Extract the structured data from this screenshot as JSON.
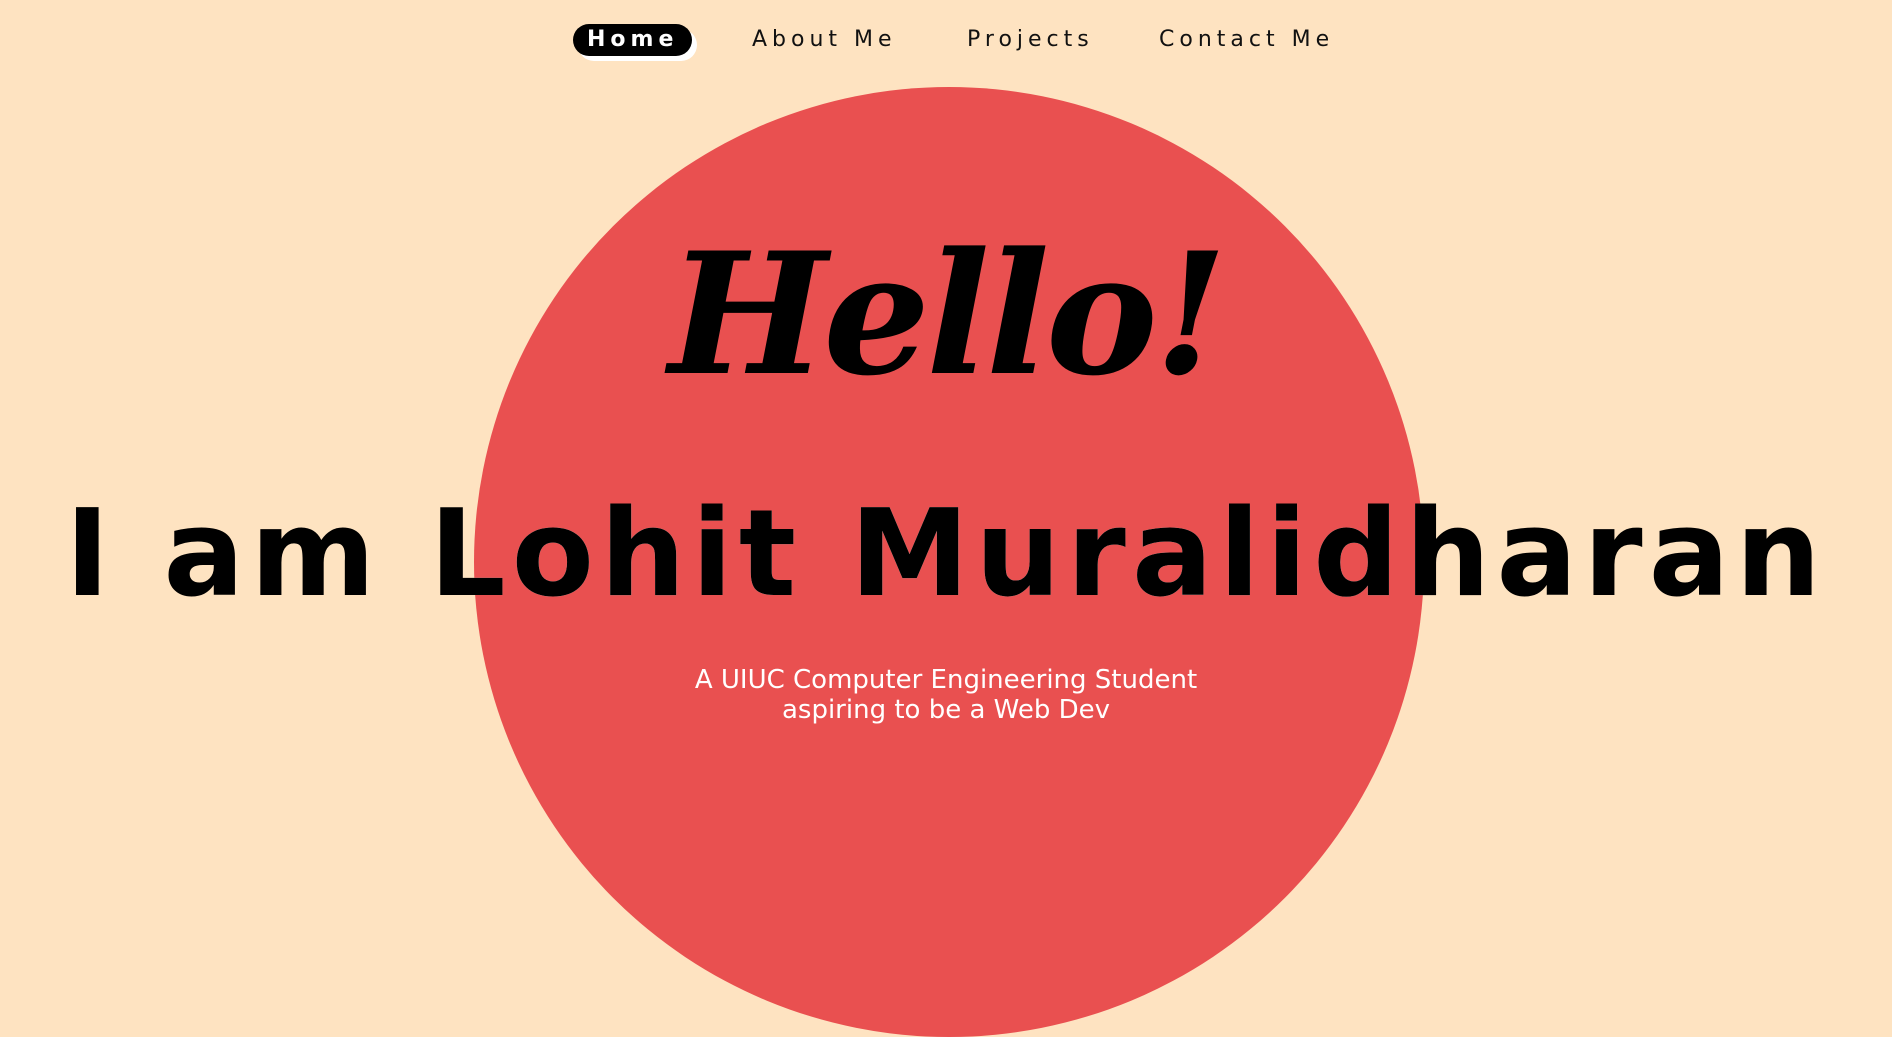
{
  "nav": {
    "items": [
      {
        "label": "Home",
        "active": true
      },
      {
        "label": "About Me",
        "active": false
      },
      {
        "label": "Projects",
        "active": false
      },
      {
        "label": "Contact Me",
        "active": false
      }
    ]
  },
  "hero": {
    "greeting": "Hello!",
    "name_line": "I am Lohit Muralidharan",
    "subtitle_line1": "A UIUC Computer Engineering Student",
    "subtitle_line2": "aspiring to be a Web Dev"
  },
  "colors": {
    "background": "#FEE3C1",
    "circle": "#E95050",
    "text_dark": "#000000",
    "text_light": "#FFFFFF"
  }
}
